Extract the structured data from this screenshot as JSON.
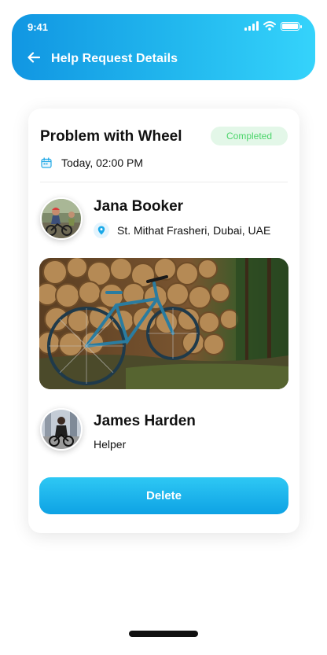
{
  "status_bar": {
    "time": "9:41"
  },
  "header": {
    "title": "Help Request Details",
    "back_icon": "arrow-left-icon"
  },
  "request": {
    "title": "Problem with Wheel",
    "status": "Completed",
    "datetime": "Today, 02:00 PM",
    "requester": {
      "name": "Jana Booker",
      "location": "St. Mithat Frasheri, Dubai, UAE"
    },
    "helper": {
      "name": "James Harden",
      "role": "Helper"
    }
  },
  "actions": {
    "delete_label": "Delete"
  },
  "colors": {
    "accent": "#1aa9e8",
    "header_gradient_start": "#1196e2",
    "header_gradient_end": "#35d3fb",
    "status_text": "#4cd56b",
    "status_background": "#e3f7e8"
  }
}
